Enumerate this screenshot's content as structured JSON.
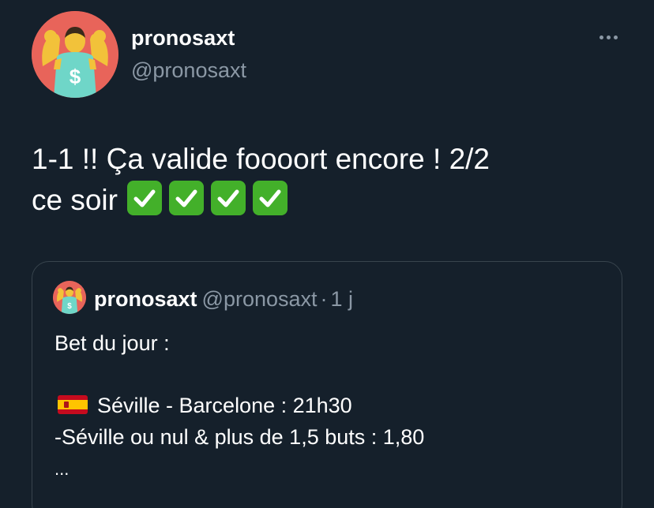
{
  "author": {
    "name": "pronosaxt",
    "handle": "@pronosaxt"
  },
  "tweet": {
    "text_line1": "1-1 !! Ça valide foooort encore ! 2/2",
    "text_line2": "ce soir",
    "emoji": [
      "white-check-mark",
      "white-check-mark",
      "white-check-mark",
      "white-check-mark"
    ]
  },
  "quoted_tweet": {
    "name": "pronosaxt",
    "handle": "@pronosaxt",
    "separator": "·",
    "time": "1 j",
    "line1": "Bet du jour :",
    "match": "Séville - Barcelone : 21h30",
    "flag": "spain-flag",
    "bet": "-Séville ou nul & plus de 1,5 buts : 1,80",
    "ellipsis": "..."
  },
  "colors": {
    "background": "#15202b",
    "secondary_text": "#8b98a5",
    "border": "#38444d",
    "check_green": "#43b02a"
  }
}
